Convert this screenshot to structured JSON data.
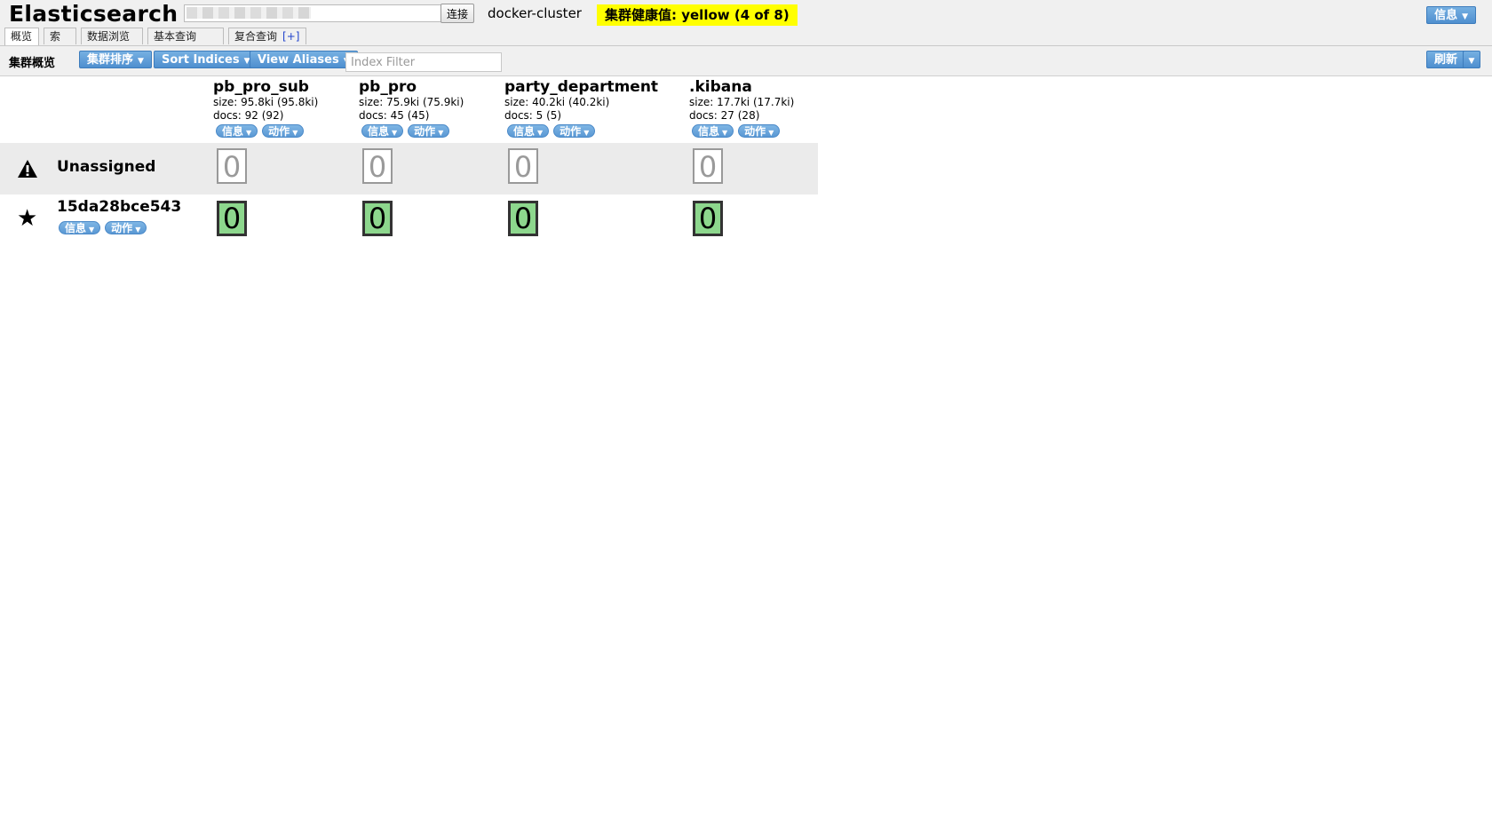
{
  "app": {
    "title": "Elasticsearch"
  },
  "connection": {
    "url_value": "",
    "connect_label": "连接",
    "cluster_name": "docker-cluster",
    "health_text": "集群健康值: yellow (4 of 8)",
    "health_color": "#ffff00"
  },
  "header": {
    "info_label": "信息"
  },
  "tabs": [
    {
      "label": "概览",
      "plus": ""
    },
    {
      "label": "索引",
      "plus": ""
    },
    {
      "label": "数据浏览",
      "plus": ""
    },
    {
      "label": "基本查询",
      "plus": "[+]"
    },
    {
      "label": "复合查询",
      "plus": "[+]"
    }
  ],
  "toolbar": {
    "title": "集群概览",
    "sort_cluster_label": "集群排序",
    "sort_indices_label": "Sort Indices",
    "view_aliases_label": "View Aliases",
    "index_filter_placeholder": "Index Filter",
    "refresh_label": "刷新"
  },
  "indices": [
    {
      "name": "pb_pro_sub",
      "size": "size: 95.8ki (95.8ki)",
      "docs": "docs: 92 (92)",
      "info_label": "信息",
      "action_label": "动作"
    },
    {
      "name": "pb_pro",
      "size": "size: 75.9ki (75.9ki)",
      "docs": "docs: 45 (45)",
      "info_label": "信息",
      "action_label": "动作"
    },
    {
      "name": "party_department",
      "size": "size: 40.2ki (40.2ki)",
      "docs": "docs: 5 (5)",
      "info_label": "信息",
      "action_label": "动作"
    },
    {
      "name": ".kibana",
      "size": "size: 17.7ki (17.7ki)",
      "docs": "docs: 27 (28)",
      "info_label": "信息",
      "action_label": "动作"
    }
  ],
  "rows": {
    "unassigned": {
      "label": "Unassigned",
      "icon": "warning-icon",
      "shards": [
        "0",
        "0",
        "0",
        "0"
      ]
    },
    "node": {
      "label": "15da28bce543",
      "icon": "star-icon",
      "info_label": "信息",
      "action_label": "动作",
      "shards": [
        "0",
        "0",
        "0",
        "0"
      ]
    }
  },
  "colors": {
    "accent_blue": "#5a98d4",
    "shard_started": "#8dd78d"
  }
}
